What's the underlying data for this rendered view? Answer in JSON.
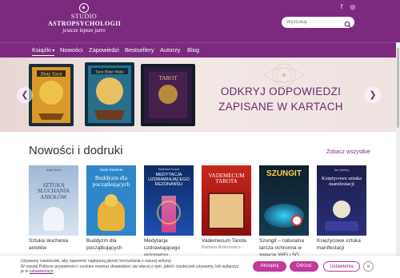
{
  "header": {
    "logo_line1": "STUDIO",
    "logo_line2": "ASTROPSYCHOLOGII",
    "logo_line3": "jeszcze lepsze jutro",
    "search": {
      "placeholder": "Wyszukaj"
    },
    "social": [
      {
        "icon": "facebook-icon",
        "glyph": "f"
      },
      {
        "icon": "instagram-icon",
        "glyph": "◎"
      }
    ]
  },
  "nav": {
    "items": [
      {
        "label": "Książki",
        "icon": "chevron-down-icon",
        "active": true
      },
      {
        "label": "Nowości"
      },
      {
        "label": "Zapowiedzi"
      },
      {
        "label": "Bestsellery"
      },
      {
        "label": "Autorzy"
      },
      {
        "label": "Blog"
      }
    ]
  },
  "banner": {
    "line1": "ODKRYJ ODPOWIEDZI",
    "line2": "ZAPISANE W KARTACH",
    "card_box_titles": [
      "Złoty Tarot",
      "Tarot Rider Waite",
      "TAROT"
    ]
  },
  "section": {
    "title": "Nowości i dodruki",
    "see_all": "Zobacz wszystkie"
  },
  "books": [
    {
      "title": "Sztuka słuchania aniołów",
      "author": "",
      "cover_title": "SZTUKA SŁUCHANIA ANIOŁÓW",
      "cover_author": "Kate Dent"
    },
    {
      "title": "Buddyzm dla początkujących",
      "author": "",
      "cover_title": "Buddyzm dla początkujących",
      "cover_author": "Noah Rasheta"
    },
    {
      "title": "Medytacja uzdrawiającego rezonansu",
      "author": "",
      "cover_title": "MEDYTACJA UZDRAWIAJĄCEGO REZONANSU",
      "cover_author": "Barbara Krupa"
    },
    {
      "title": "Vademecum Tarota",
      "author": "Barbara Antonowicz -",
      "cover_title": "VADEMECUM TAROTA",
      "cover_author": ""
    },
    {
      "title": "Szungit – naturalna tarcza ochronna w świecie WiFi i 5G",
      "author": "",
      "cover_title": "SZUNGIT",
      "cover_author": ""
    },
    {
      "title": "Księżycowe sztuka manifestacji",
      "author": "",
      "cover_title": "Księżycowe sztuka manifestacji",
      "cover_author": "Ian Ashley"
    }
  ],
  "cookie": {
    "line1": "Używamy ciasteczek, aby zapewnić najlepszą jakość korzystania z naszej witryny.",
    "line2": "W naszej Polityce prywatności i cookies możesz dowiedzieć się więcej o tym, jakich ciasteczek używamy, lub wyłączyć",
    "line3_prefix": "je w",
    "link": "ustawieniach",
    "line3_suffix": ".",
    "accept": "Akceptuj",
    "reject": "Odrzuć",
    "settings": "Ustawienia",
    "close": "×"
  },
  "colors": {
    "brand": "#7b2a7f",
    "accent_button": "#c0399b",
    "banner_bg": "#f1e6e5"
  }
}
